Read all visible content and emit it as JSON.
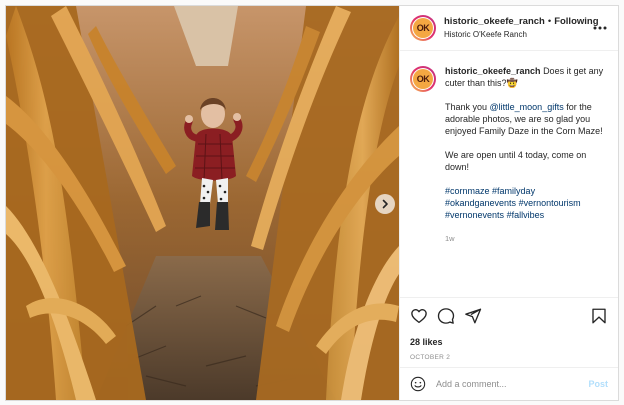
{
  "header": {
    "avatar_text": "OK",
    "username": "historic_okeefe_ranch",
    "separator": "•",
    "follow_status": "Following",
    "location": "Historic O'Keefe Ranch",
    "more_icon": "more-horizontal-icon"
  },
  "caption": {
    "username": "historic_okeefe_ranch",
    "intro": "Does it get any cuter than this?🤠",
    "thanks_prefix": "Thank you ",
    "mention": "@little_moon_gifts",
    "thanks_suffix": " for the adorable photos, we are so glad you enjoyed Family Daze in the Corn Maze!",
    "hours": "We are open until 4 today, come on down!",
    "hashtags": [
      "#cornmaze",
      "#familyday",
      "#okandganevents",
      "#vernontourism",
      "#vernonevents",
      "#fallvibes"
    ],
    "age": "1w"
  },
  "actions": {
    "like_icon": "heart-icon",
    "comment_icon": "comment-icon",
    "share_icon": "share-icon",
    "save_icon": "bookmark-icon",
    "likes": "28 likes",
    "date": "OCTOBER 2"
  },
  "comment_box": {
    "emoji_icon": "emoji-icon",
    "placeholder": "Add a comment...",
    "post_label": "Post"
  },
  "media": {
    "next_icon": "chevron-right-icon"
  },
  "colors": {
    "link": "#00376b",
    "post_disabled": "#b2dffc",
    "avatar_bg": "#f4a742"
  }
}
